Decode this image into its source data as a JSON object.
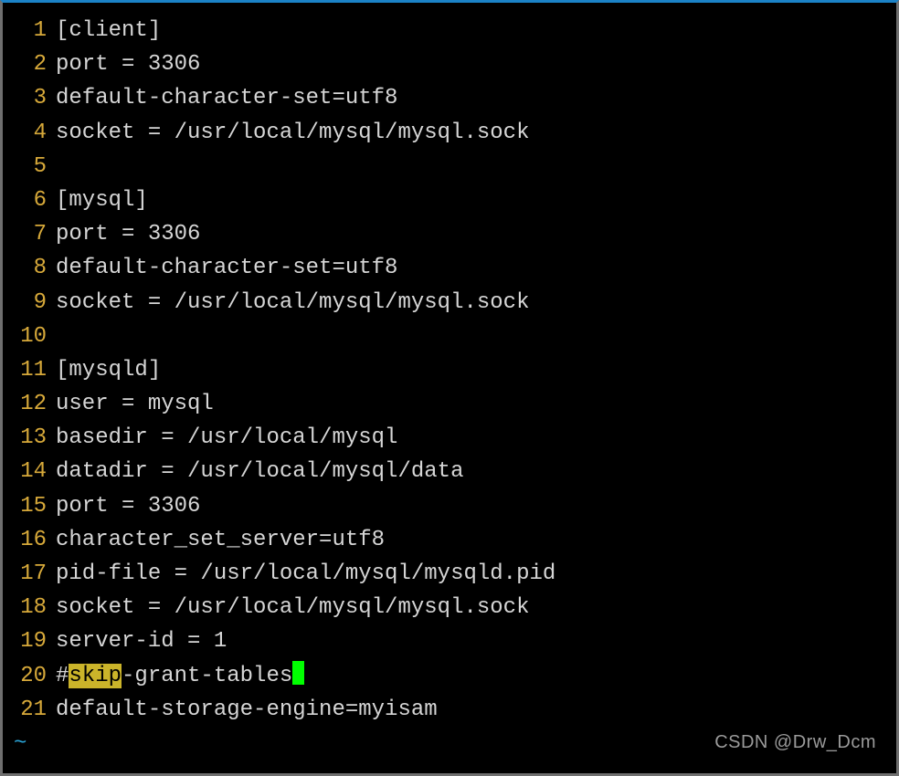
{
  "lines": [
    {
      "n": 1,
      "text": "[client]"
    },
    {
      "n": 2,
      "text": "port = 3306"
    },
    {
      "n": 3,
      "text": "default-character-set=utf8"
    },
    {
      "n": 4,
      "text": "socket = /usr/local/mysql/mysql.sock"
    },
    {
      "n": 5,
      "text": ""
    },
    {
      "n": 6,
      "text": "[mysql]"
    },
    {
      "n": 7,
      "text": "port = 3306"
    },
    {
      "n": 8,
      "text": "default-character-set=utf8"
    },
    {
      "n": 9,
      "text": "socket = /usr/local/mysql/mysql.sock"
    },
    {
      "n": 10,
      "text": ""
    },
    {
      "n": 11,
      "text": "[mysqld]"
    },
    {
      "n": 12,
      "text": "user = mysql"
    },
    {
      "n": 13,
      "text": "basedir = /usr/local/mysql"
    },
    {
      "n": 14,
      "text": "datadir = /usr/local/mysql/data"
    },
    {
      "n": 15,
      "text": "port = 3306"
    },
    {
      "n": 16,
      "text": "character_set_server=utf8"
    },
    {
      "n": 17,
      "text": "pid-file = /usr/local/mysql/mysqld.pid"
    },
    {
      "n": 18,
      "text": "socket = /usr/local/mysql/mysql.sock"
    },
    {
      "n": 19,
      "text": "server-id = 1"
    },
    {
      "n": 21,
      "text": "default-storage-engine=myisam"
    }
  ],
  "line20": {
    "n": 20,
    "pre": "#",
    "highlight": "skip",
    "post": "-grant-tables"
  },
  "tilde": "~",
  "watermark": "CSDN @Drw_Dcm"
}
